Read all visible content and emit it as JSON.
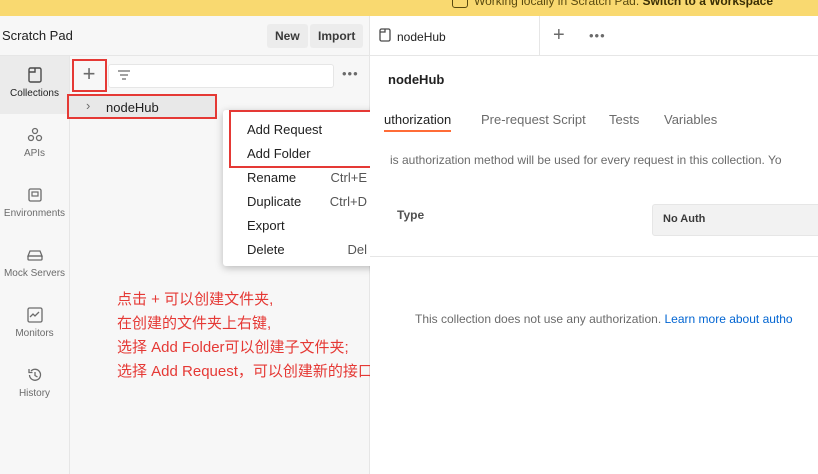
{
  "banner": {
    "text": "Working locally in Scratch Pad.",
    "link": "Switch to a Workspace"
  },
  "workspace": {
    "title": "Scratch Pad",
    "new_label": "New",
    "import_label": "Import"
  },
  "sidebar": {
    "items": [
      {
        "label": "Collections",
        "icon": "collections-icon"
      },
      {
        "label": "APIs",
        "icon": "apis-icon"
      },
      {
        "label": "Environments",
        "icon": "environments-icon"
      },
      {
        "label": "Mock Servers",
        "icon": "mock-servers-icon"
      },
      {
        "label": "Monitors",
        "icon": "monitors-icon"
      },
      {
        "label": "History",
        "icon": "history-icon"
      }
    ]
  },
  "collections": {
    "add_label": "+",
    "more_label": "•••",
    "tree": [
      {
        "label": "nodeHub",
        "expanded": false
      }
    ]
  },
  "context_menu": {
    "items": [
      {
        "label": "Add Request",
        "shortcut": ""
      },
      {
        "label": "Add Folder",
        "shortcut": ""
      },
      {
        "label": "Rename",
        "shortcut": "Ctrl+E"
      },
      {
        "label": "Duplicate",
        "shortcut": "Ctrl+D"
      },
      {
        "label": "Export",
        "shortcut": ""
      },
      {
        "label": "Delete",
        "shortcut": "Del"
      }
    ]
  },
  "annotation": {
    "lines": [
      "点击 + 可以创建文件夹,",
      "在创建的文件夹上右键,",
      "选择 Add Folder可以创建子文件夹;",
      "选择 Add Request，可以创建新的接口请求"
    ]
  },
  "tabs": {
    "open": [
      {
        "label": "nodeHub"
      }
    ],
    "add_label": "+",
    "more_label": "•••"
  },
  "collection_view": {
    "title": "nodeHub",
    "subtabs": [
      "uthorization",
      "Pre-request Script",
      "Tests",
      "Variables"
    ],
    "description": "is authorization method will be used for every request in this collection. Yo",
    "type_label": "Type",
    "auth_value": "No Auth",
    "no_auth_text": "This collection does not use any authorization.",
    "learn_more": "Learn more about autho"
  },
  "colors": {
    "banner_bg": "#f9d970",
    "accent": "#ff6c37",
    "annotation": "#e53935",
    "link": "#0265d2"
  }
}
